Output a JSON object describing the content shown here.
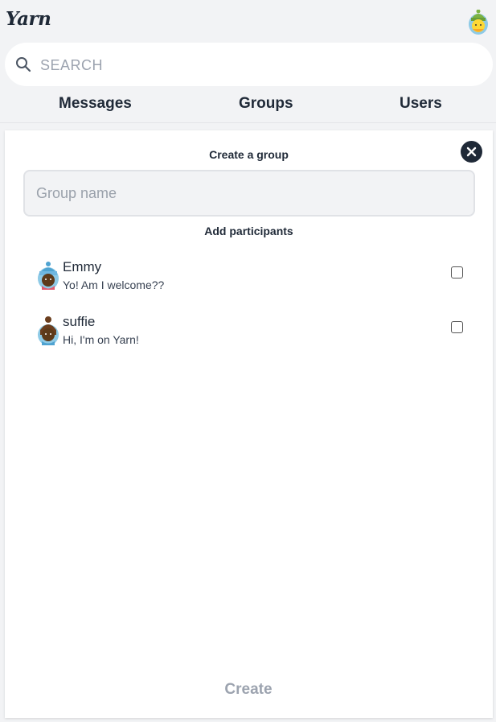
{
  "app": {
    "logo_text": "Yarn"
  },
  "search": {
    "placeholder": "SEARCH",
    "value": ""
  },
  "tabs": [
    {
      "label": "Messages"
    },
    {
      "label": "Groups"
    },
    {
      "label": "Users"
    }
  ],
  "create_group": {
    "title": "Create a group",
    "group_name_placeholder": "Group name",
    "group_name_value": "",
    "participants_title": "Add participants",
    "participants": [
      {
        "name": "Emmy",
        "status": "Yo! Am I welcome??",
        "checked": false
      },
      {
        "name": "suffie",
        "status": "Hi, I'm on Yarn!",
        "checked": false
      }
    ],
    "create_label": "Create"
  },
  "colors": {
    "background": "#f2f3f5",
    "panel": "#ffffff",
    "text": "#1f2937",
    "muted": "#9ca3af",
    "close_button": "#1f2937"
  },
  "icons": [
    "avatar-icon",
    "search-icon",
    "close-icon",
    "checkbox"
  ]
}
